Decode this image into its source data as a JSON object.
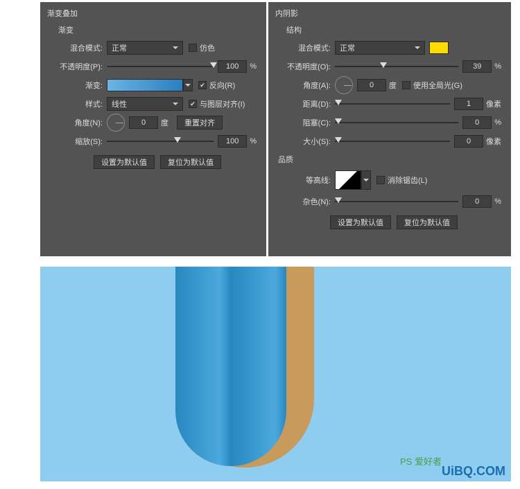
{
  "left": {
    "title": "渐变叠加",
    "sub": "渐变",
    "blend_label": "混合模式:",
    "blend_value": "正常",
    "dither": "仿色",
    "opacity_label": "不透明度(P):",
    "opacity": "100",
    "gradient_label": "渐变:",
    "reverse": "反向(R)",
    "style_label": "样式:",
    "style_value": "线性",
    "align": "与图层对齐(I)",
    "angle_label": "角度(N):",
    "angle": "0",
    "deg": "度",
    "reset_align": "重置对齐",
    "scale_label": "缩放(S):",
    "scale": "100",
    "pct": "%",
    "set_default": "设置为默认值",
    "reset_default": "复位为默认值"
  },
  "right": {
    "title": "内阴影",
    "sub": "结构",
    "blend_label": "混合模式:",
    "blend_value": "正常",
    "opacity_label": "不透明度(O):",
    "opacity": "39",
    "angle_label": "角度(A):",
    "angle": "0",
    "deg": "度",
    "global": "使用全局光(G)",
    "distance_label": "距离(D):",
    "distance": "1",
    "px": "像素",
    "choke_label": "阻塞(C):",
    "choke": "0",
    "size_label": "大小(S):",
    "size": "0",
    "pct": "%",
    "quality": "品质",
    "contour_label": "等高线:",
    "antialias": "消除锯齿(L)",
    "noise_label": "杂色(N):",
    "noise": "0",
    "set_default": "设置为默认值",
    "reset_default": "复位为默认值"
  },
  "watermark": "UiBQ.COM",
  "wm2": "PS 爱好者"
}
